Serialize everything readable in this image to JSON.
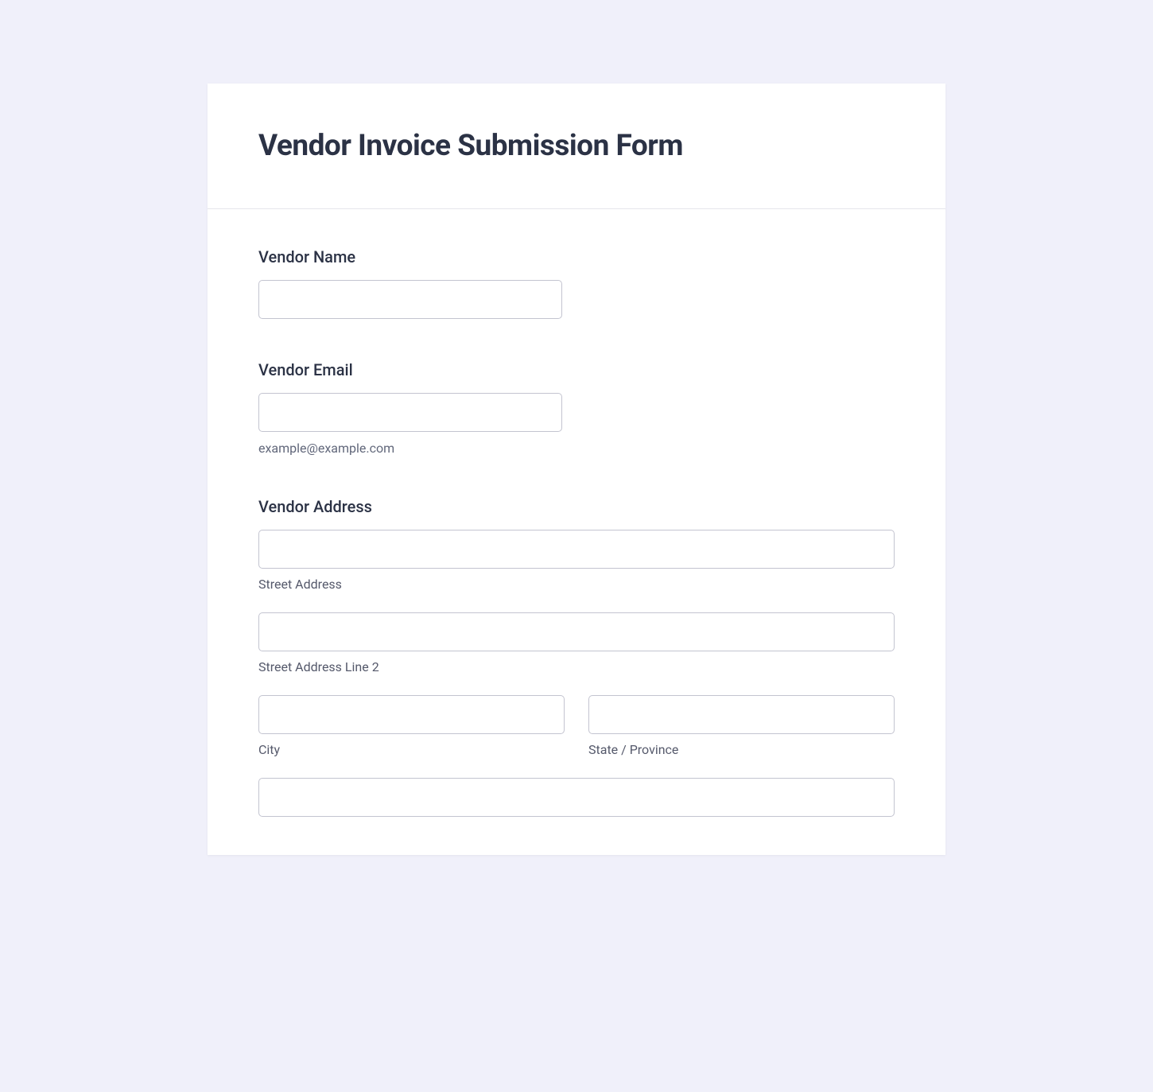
{
  "form": {
    "title": "Vendor Invoice Submission Form",
    "fields": {
      "vendor_name": {
        "label": "Vendor Name",
        "value": ""
      },
      "vendor_email": {
        "label": "Vendor Email",
        "value": "",
        "hint": "example@example.com"
      },
      "vendor_address": {
        "label": "Vendor Address",
        "street1": {
          "sublabel": "Street Address",
          "value": ""
        },
        "street2": {
          "sublabel": "Street Address Line 2",
          "value": ""
        },
        "city": {
          "sublabel": "City",
          "value": ""
        },
        "state": {
          "sublabel": "State / Province",
          "value": ""
        }
      }
    }
  }
}
